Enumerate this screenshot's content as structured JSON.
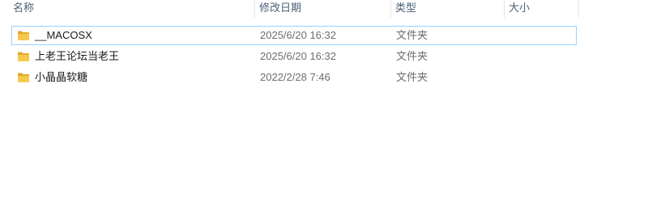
{
  "columns": {
    "name": "名称",
    "modified": "修改日期",
    "type": "类型",
    "size": "大小"
  },
  "files": [
    {
      "name": "__MACOSX",
      "modified": "2025/6/20 16:32",
      "type": "文件夹",
      "size": "",
      "icon": "folder-icon",
      "selected": true
    },
    {
      "name": "上老王论坛当老王",
      "modified": "2025/6/20 16:32",
      "type": "文件夹",
      "size": "",
      "icon": "folder-icon",
      "selected": false
    },
    {
      "name": "小晶晶软糖",
      "modified": "2022/2/28 7:46",
      "type": "文件夹",
      "size": "",
      "icon": "folder-icon",
      "selected": false
    }
  ],
  "colors": {
    "folder": "#f6c94e",
    "folder_dark": "#e3a92b",
    "selection_border": "#99d1ff",
    "header_text": "#4c607a"
  }
}
